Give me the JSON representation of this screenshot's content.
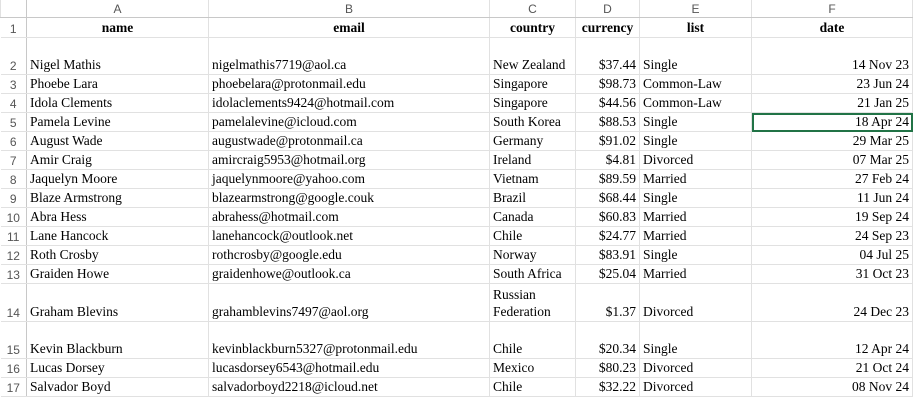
{
  "sheet": {
    "column_letters": [
      "A",
      "B",
      "C",
      "D",
      "E",
      "F"
    ],
    "headers": [
      "name",
      "email",
      "country",
      "currency",
      "list",
      "date"
    ],
    "rows": [
      {
        "n": "2",
        "name": "Nigel Mathis",
        "email": "nigelmathis7719@aol.ca",
        "country": "New Zealand",
        "currency": "$37.44",
        "list": "Single",
        "date": "14 Nov 23"
      },
      {
        "n": "3",
        "name": "Phoebe Lara",
        "email": "phoebelara@protonmail.edu",
        "country": "Singapore",
        "currency": "$98.73",
        "list": "Common-Law",
        "date": "23 Jun 24"
      },
      {
        "n": "4",
        "name": "Idola Clements",
        "email": "idolaclements9424@hotmail.com",
        "country": "Singapore",
        "currency": "$44.56",
        "list": "Common-Law",
        "date": "21 Jan 25"
      },
      {
        "n": "5",
        "name": "Pamela Levine",
        "email": "pamelalevine@icloud.com",
        "country": "South Korea",
        "currency": "$88.53",
        "list": "Single",
        "date": "18 Apr 24"
      },
      {
        "n": "6",
        "name": "August Wade",
        "email": "augustwade@protonmail.ca",
        "country": "Germany",
        "currency": "$91.02",
        "list": "Single",
        "date": "29 Mar 25"
      },
      {
        "n": "7",
        "name": "Amir Craig",
        "email": "amircraig5953@hotmail.org",
        "country": "Ireland",
        "currency": "$4.81",
        "list": "Divorced",
        "date": "07 Mar 25"
      },
      {
        "n": "8",
        "name": "Jaquelyn Moore",
        "email": "jaquelynmoore@yahoo.com",
        "country": "Vietnam",
        "currency": "$89.59",
        "list": "Married",
        "date": "27 Feb 24"
      },
      {
        "n": "9",
        "name": "Blaze Armstrong",
        "email": "blazearmstrong@google.couk",
        "country": "Brazil",
        "currency": "$68.44",
        "list": "Single",
        "date": "11 Jun 24"
      },
      {
        "n": "10",
        "name": "Abra Hess",
        "email": "abrahess@hotmail.com",
        "country": "Canada",
        "currency": "$60.83",
        "list": "Married",
        "date": "19 Sep 24"
      },
      {
        "n": "11",
        "name": "Lane Hancock",
        "email": "lanehancock@outlook.net",
        "country": "Chile",
        "currency": "$24.77",
        "list": "Married",
        "date": "24 Sep 23"
      },
      {
        "n": "12",
        "name": "Roth Crosby",
        "email": "rothcrosby@google.edu",
        "country": "Norway",
        "currency": "$83.91",
        "list": "Single",
        "date": "04 Jul 25"
      },
      {
        "n": "13",
        "name": "Graiden Howe",
        "email": "graidenhowe@outlook.ca",
        "country": "South Africa",
        "currency": "$25.04",
        "list": "Married",
        "date": "31 Oct 23"
      },
      {
        "n": "14",
        "name": "Graham Blevins",
        "email": "grahamblevins7497@aol.org",
        "country": "Russian Federation",
        "currency": "$1.37",
        "list": "Divorced",
        "date": "24 Dec 23"
      },
      {
        "n": "15",
        "name": "Kevin Blackburn",
        "email": "kevinblackburn5327@protonmail.edu",
        "country": "Chile",
        "currency": "$20.34",
        "list": "Single",
        "date": "12 Apr 24"
      },
      {
        "n": "16",
        "name": "Lucas Dorsey",
        "email": "lucasdorsey6543@hotmail.edu",
        "country": "Mexico",
        "currency": "$80.23",
        "list": "Divorced",
        "date": "21 Oct 24"
      },
      {
        "n": "17",
        "name": "Salvador Boyd",
        "email": "salvadorboyd2218@icloud.net",
        "country": "Chile",
        "currency": "$32.22",
        "list": "Divorced",
        "date": "08 Nov 24"
      }
    ]
  },
  "colors": {
    "grid": "#e1e1e1",
    "header_text": "#555555",
    "selection": "#217346"
  }
}
